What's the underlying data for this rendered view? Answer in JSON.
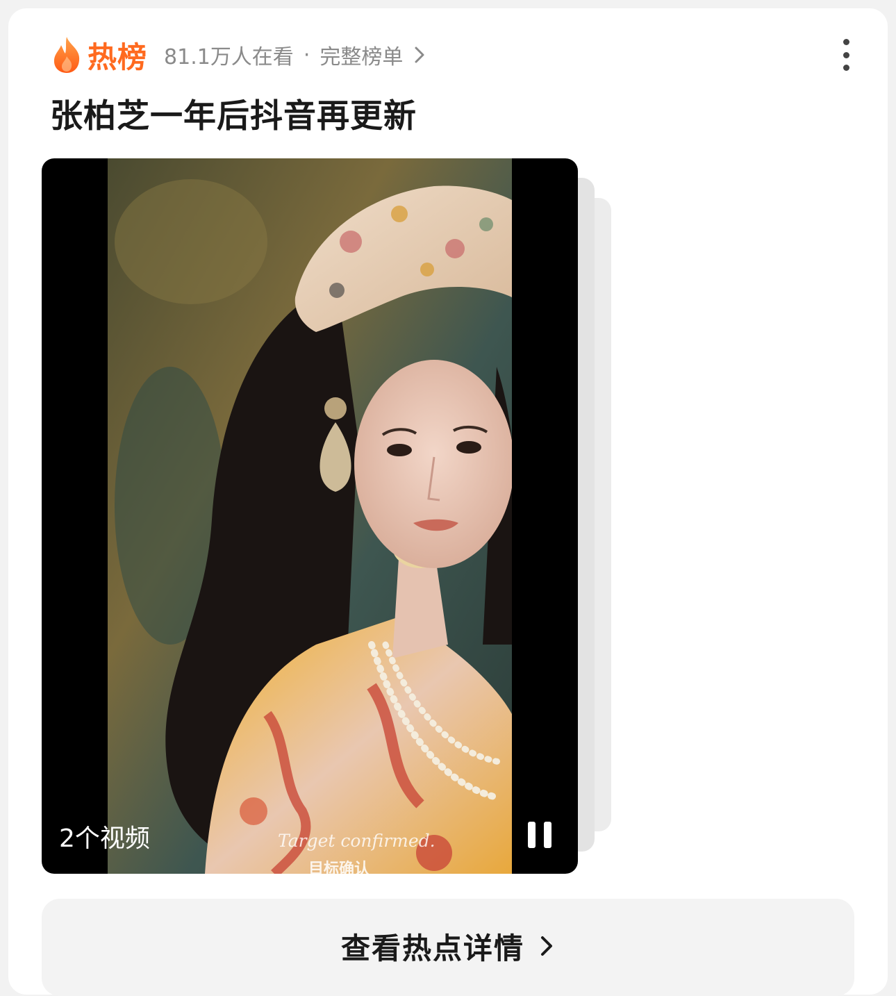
{
  "header": {
    "icon": "flame-icon",
    "accent_color": "#ff6a1f",
    "hot_label": "热榜",
    "watch_count": "81.1万人在看",
    "separator": "·",
    "full_list_label": "完整榜单",
    "menu_icon": "more-vertical-icon"
  },
  "topic": {
    "title": "张柏芝一年后抖音再更新"
  },
  "video": {
    "caption_en": "Target confirmed.",
    "caption_cn": "目标确认",
    "count_label": "2个视频",
    "control_icon": "pause-icon"
  },
  "footer": {
    "detail_label": "查看热点详情"
  }
}
